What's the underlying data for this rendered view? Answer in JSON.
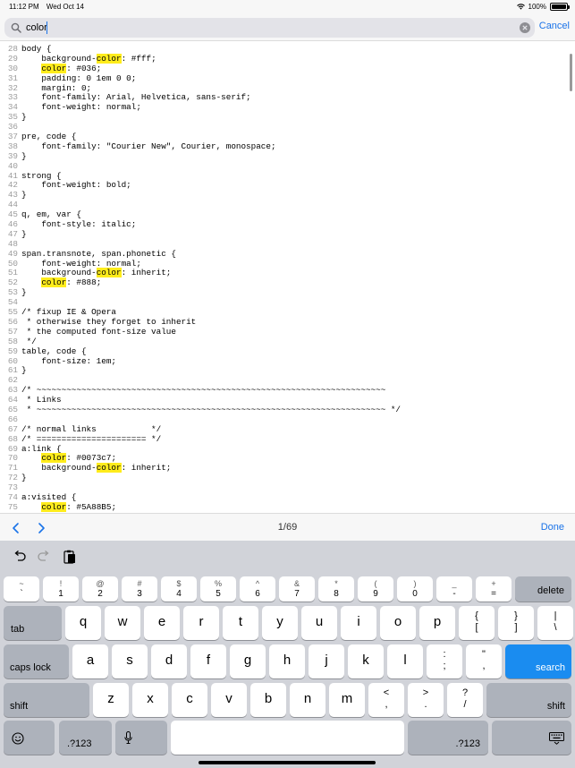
{
  "status_bar": {
    "time": "11:12 PM",
    "date": "Wed Oct 14",
    "battery": "100%"
  },
  "search": {
    "value": "color",
    "cancel_label": "Cancel"
  },
  "code_lines": [
    {
      "n": "28",
      "parts": [
        {
          "t": "body {"
        }
      ]
    },
    {
      "n": "29",
      "parts": [
        {
          "t": "    background-"
        },
        {
          "t": "color",
          "hl": true
        },
        {
          "t": ": #fff;"
        }
      ]
    },
    {
      "n": "30",
      "parts": [
        {
          "t": "    "
        },
        {
          "t": "color",
          "hl": true
        },
        {
          "t": ": #036;"
        }
      ]
    },
    {
      "n": "31",
      "parts": [
        {
          "t": "    padding: 0 1em 0 0;"
        }
      ]
    },
    {
      "n": "32",
      "parts": [
        {
          "t": "    margin: 0;"
        }
      ]
    },
    {
      "n": "33",
      "parts": [
        {
          "t": "    font-family: Arial, Helvetica, sans-serif;"
        }
      ]
    },
    {
      "n": "34",
      "parts": [
        {
          "t": "    font-weight: normal;"
        }
      ]
    },
    {
      "n": "35",
      "parts": [
        {
          "t": "}"
        }
      ]
    },
    {
      "n": "36",
      "parts": [
        {
          "t": ""
        }
      ]
    },
    {
      "n": "37",
      "parts": [
        {
          "t": "pre, code {"
        }
      ]
    },
    {
      "n": "38",
      "parts": [
        {
          "t": "    font-family: \"Courier New\", Courier, monospace;"
        }
      ]
    },
    {
      "n": "39",
      "parts": [
        {
          "t": "}"
        }
      ]
    },
    {
      "n": "40",
      "parts": [
        {
          "t": ""
        }
      ]
    },
    {
      "n": "41",
      "parts": [
        {
          "t": "strong {"
        }
      ]
    },
    {
      "n": "42",
      "parts": [
        {
          "t": "    font-weight: bold;"
        }
      ]
    },
    {
      "n": "43",
      "parts": [
        {
          "t": "}"
        }
      ]
    },
    {
      "n": "44",
      "parts": [
        {
          "t": ""
        }
      ]
    },
    {
      "n": "45",
      "parts": [
        {
          "t": "q, em, var {"
        }
      ]
    },
    {
      "n": "46",
      "parts": [
        {
          "t": "    font-style: italic;"
        }
      ]
    },
    {
      "n": "47",
      "parts": [
        {
          "t": "}"
        }
      ]
    },
    {
      "n": "48",
      "parts": [
        {
          "t": ""
        }
      ]
    },
    {
      "n": "49",
      "parts": [
        {
          "t": "span.transnote, span.phonetic {"
        }
      ]
    },
    {
      "n": "50",
      "parts": [
        {
          "t": "    font-weight: normal;"
        }
      ]
    },
    {
      "n": "51",
      "parts": [
        {
          "t": "    background-"
        },
        {
          "t": "color",
          "hl": true
        },
        {
          "t": ": inherit;"
        }
      ]
    },
    {
      "n": "52",
      "parts": [
        {
          "t": "    "
        },
        {
          "t": "color",
          "hl": true
        },
        {
          "t": ": #888;"
        }
      ]
    },
    {
      "n": "53",
      "parts": [
        {
          "t": "}"
        }
      ]
    },
    {
      "n": "54",
      "parts": [
        {
          "t": ""
        }
      ]
    },
    {
      "n": "55",
      "parts": [
        {
          "t": "/* fixup IE & Opera"
        }
      ]
    },
    {
      "n": "56",
      "parts": [
        {
          "t": " * otherwise they forget to inherit"
        }
      ]
    },
    {
      "n": "57",
      "parts": [
        {
          "t": " * the computed font-size value"
        }
      ]
    },
    {
      "n": "58",
      "parts": [
        {
          "t": " */"
        }
      ]
    },
    {
      "n": "59",
      "parts": [
        {
          "t": "table, code {"
        }
      ]
    },
    {
      "n": "60",
      "parts": [
        {
          "t": "    font-size: 1em;"
        }
      ]
    },
    {
      "n": "61",
      "parts": [
        {
          "t": "}"
        }
      ]
    },
    {
      "n": "62",
      "parts": [
        {
          "t": ""
        }
      ]
    },
    {
      "n": "63",
      "parts": [
        {
          "t": "/* ~~~~~~~~~~~~~~~~~~~~~~~~~~~~~~~~~~~~~~~~~~~~~~~~~~~~~~~~~~~~~~~~~~~~~~"
        }
      ]
    },
    {
      "n": "64",
      "parts": [
        {
          "t": " * Links"
        }
      ]
    },
    {
      "n": "65",
      "parts": [
        {
          "t": " * ~~~~~~~~~~~~~~~~~~~~~~~~~~~~~~~~~~~~~~~~~~~~~~~~~~~~~~~~~~~~~~~~~~~~~~ */"
        }
      ]
    },
    {
      "n": "66",
      "parts": [
        {
          "t": ""
        }
      ]
    },
    {
      "n": "67",
      "parts": [
        {
          "t": "/* normal links           */"
        }
      ]
    },
    {
      "n": "68",
      "parts": [
        {
          "t": "/* ====================== */"
        }
      ]
    },
    {
      "n": "69",
      "parts": [
        {
          "t": "a:link {"
        }
      ]
    },
    {
      "n": "70",
      "parts": [
        {
          "t": "    "
        },
        {
          "t": "color",
          "hl": true
        },
        {
          "t": ": #0073c7;"
        }
      ]
    },
    {
      "n": "71",
      "parts": [
        {
          "t": "    background-"
        },
        {
          "t": "color",
          "hl": true
        },
        {
          "t": ": inherit;"
        }
      ]
    },
    {
      "n": "72",
      "parts": [
        {
          "t": "}"
        }
      ]
    },
    {
      "n": "73",
      "parts": [
        {
          "t": ""
        }
      ]
    },
    {
      "n": "74",
      "parts": [
        {
          "t": "a:visited {"
        }
      ]
    },
    {
      "n": "75",
      "parts": [
        {
          "t": "    "
        },
        {
          "t": "color",
          "hl": true
        },
        {
          "t": ": #5A88B5;"
        }
      ]
    }
  ],
  "find_bar": {
    "counter": "1/69",
    "done_label": "Done"
  },
  "keyboard": {
    "number_row": [
      {
        "top": "~",
        "bottom": "`"
      },
      {
        "top": "!",
        "bottom": "1"
      },
      {
        "top": "@",
        "bottom": "2"
      },
      {
        "top": "#",
        "bottom": "3"
      },
      {
        "top": "$",
        "bottom": "4"
      },
      {
        "top": "%",
        "bottom": "5"
      },
      {
        "top": "^",
        "bottom": "6"
      },
      {
        "top": "&",
        "bottom": "7"
      },
      {
        "top": "*",
        "bottom": "8"
      },
      {
        "top": "(",
        "bottom": "9"
      },
      {
        "top": ")",
        "bottom": "0"
      },
      {
        "top": "_",
        "bottom": "-"
      },
      {
        "top": "+",
        "bottom": "="
      }
    ],
    "delete_label": "delete",
    "tab_label": "tab",
    "row_q": [
      "q",
      "w",
      "e",
      "r",
      "t",
      "y",
      "u",
      "i",
      "o",
      "p"
    ],
    "row_q_extra": [
      {
        "top": "{",
        "bottom": "["
      },
      {
        "top": "}",
        "bottom": "]"
      },
      {
        "top": "|",
        "bottom": "\\"
      }
    ],
    "caps_label": "caps lock",
    "row_a": [
      "a",
      "s",
      "d",
      "f",
      "g",
      "h",
      "j",
      "k",
      "l"
    ],
    "row_a_extra": [
      {
        "top": ":",
        "bottom": ";"
      },
      {
        "top": "\"",
        "bottom": ","
      }
    ],
    "search_label": "search",
    "shift_label": "shift",
    "row_z": [
      "z",
      "x",
      "c",
      "v",
      "b",
      "n",
      "m"
    ],
    "row_z_extra": [
      {
        "top": "<",
        "bottom": ","
      },
      {
        "top": ">",
        "bottom": "."
      },
      {
        "top": "?",
        "bottom": "/"
      }
    ],
    "numbers_label": ".?123",
    "icons": [
      "emoji-icon",
      "mic-icon",
      "keyboard-hide-icon",
      "undo-icon",
      "redo-icon",
      "paste-icon"
    ]
  }
}
